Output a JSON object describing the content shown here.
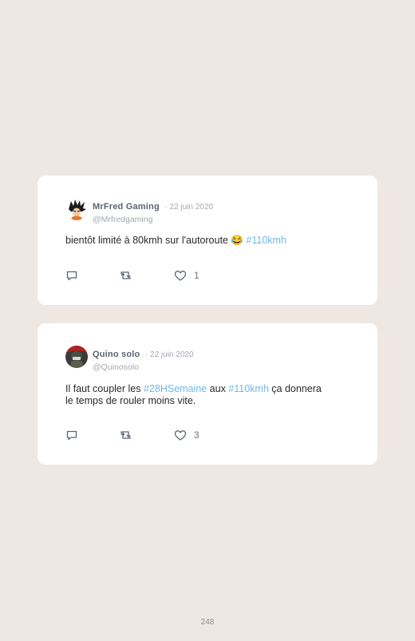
{
  "tweets": [
    {
      "name": "MrFred Gaming",
      "date": "· 22 juin 2020",
      "handle": "@Mrfredgaming",
      "text_line1": "bientôt limité à 80kmh sur l'autoroute 😂 ",
      "hashtag1": "#110kmh",
      "likes": "1",
      "avatar_icon": "goku-avatar-icon"
    },
    {
      "name": "Quino solo",
      "date": "· 22 juin 2020",
      "handle": "@Quinosolo",
      "text_a": "Il faut coupler les ",
      "hashtag1": "#28HSemaine",
      "text_b": " aux ",
      "hashtag2": "#110kmh",
      "text_c": " ça donnera",
      "text_line2": "le temps de rouler moins vite.",
      "likes": "3",
      "avatar_icon": "soldier-avatar-icon"
    }
  ],
  "colors": {
    "background": "#efe7e2",
    "card": "#ffffff",
    "hashtag": "#6fb8e6",
    "name": "#5b6470",
    "muted": "#a3a9b0"
  },
  "page_number": "248"
}
